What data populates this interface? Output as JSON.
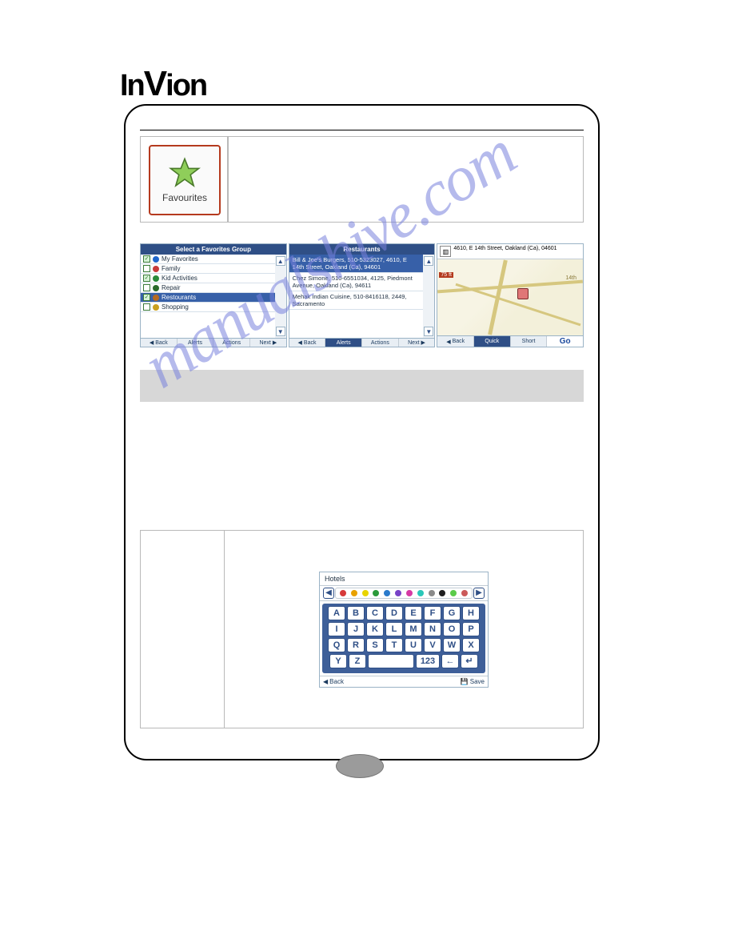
{
  "brand": "InVion",
  "watermark": "manualshive.com",
  "favourites": {
    "label": "Favourites"
  },
  "panel1": {
    "title": "Select a Favorites Group",
    "items": [
      {
        "checked": true,
        "dot": "#1f66cc",
        "label": "My Favorites",
        "sel": false
      },
      {
        "checked": false,
        "dot": "#c73a3a",
        "label": "Family",
        "sel": false
      },
      {
        "checked": true,
        "dot": "#2a8a3a",
        "label": "Kid Activities",
        "sel": false
      },
      {
        "checked": false,
        "dot": "#2a6a2a",
        "label": "Repair",
        "sel": false
      },
      {
        "checked": true,
        "dot": "#b56a20",
        "label": "Restourants",
        "sel": true
      },
      {
        "checked": false,
        "dot": "#caa020",
        "label": "Shopping",
        "sel": false
      }
    ],
    "footer": [
      "Back",
      "Alerts",
      "Actions",
      "Next"
    ]
  },
  "panel2": {
    "title": "Restaurants",
    "items": [
      {
        "text": "Bill & Joe's Burgers, 510-5323027, 4610, E 14th Street, Oakland (Ca), 94601",
        "sel": true
      },
      {
        "text": "Chez Simone, 510-6551034, 4125, Piedmont Avenue, Oakland (Ca), 94611",
        "sel": false
      },
      {
        "text": "Mehak Indian Cuisine, 510-8416118, 2449, Sacramento",
        "sel": false
      }
    ],
    "footer": [
      "Back",
      "Alerts",
      "Actions",
      "Next"
    ]
  },
  "panel3": {
    "address": "4610, E 14th Street, Oakland (Ca), 04601",
    "badge": "75 ft",
    "street_label": "14th",
    "footer": {
      "back": "Back",
      "quick": "Quick",
      "short": "Short",
      "go": "Go"
    }
  },
  "keyboard": {
    "title": "Hotels",
    "rows": [
      [
        "A",
        "B",
        "C",
        "D",
        "E",
        "F",
        "G",
        "H"
      ],
      [
        "I",
        "J",
        "K",
        "L",
        "M",
        "N",
        "O",
        "P"
      ],
      [
        "Q",
        "R",
        "S",
        "T",
        "U",
        "V",
        "W",
        "X"
      ]
    ],
    "last_row": {
      "y": "Y",
      "z": "Z",
      "num": "123",
      "bksp": "←",
      "enter": "↵"
    },
    "icon_colors": [
      "#d63a3a",
      "#e8a100",
      "#e8d400",
      "#2a9a3a",
      "#2a7acb",
      "#7742c7",
      "#d63aa4",
      "#2ac7b9",
      "#8a8a8a",
      "#1f1f1f",
      "#5acb4a",
      "#cb5a5a"
    ],
    "footer": {
      "back": "Back",
      "save": "Save"
    }
  }
}
